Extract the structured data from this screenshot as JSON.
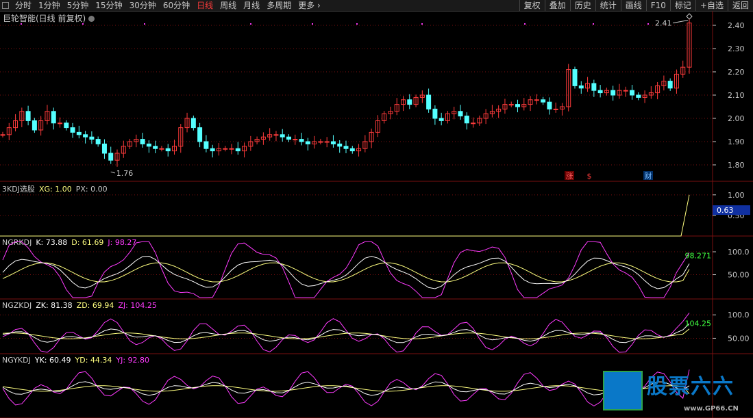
{
  "toolbar": {
    "periods": [
      "分时",
      "1分钟",
      "5分钟",
      "15分钟",
      "30分钟",
      "60分钟",
      "日线",
      "周线",
      "月线",
      "多周期",
      "更多"
    ],
    "active_period": "日线",
    "right_buttons": [
      "复权",
      "叠加",
      "历史",
      "统计",
      "画线",
      "F10",
      "标记",
      "+自选",
      "返回"
    ]
  },
  "title": "巨轮智能(日线 前复权)",
  "price_axis": [
    "2.40",
    "2.30",
    "2.20",
    "2.10",
    "2.00",
    "1.90",
    "1.80"
  ],
  "annotations": {
    "high_label": "2.41",
    "low_label": "1.76",
    "marker_zhang": "涨",
    "marker_s": "$",
    "marker_cai": "财"
  },
  "panels": {
    "kdj3": {
      "name": "3KDJ选股",
      "xg_label": "XG: 1.00",
      "px_label": "PX: 0.00",
      "axis": [
        "1.00",
        "0.50"
      ],
      "current": "0.63"
    },
    "ngrkdj": {
      "name": "NGRKDJ",
      "k_label": "K: 73.88",
      "d_label": "D: 61.69",
      "j_label": "J: 98.27",
      "axis": [
        "100.0",
        "50.00"
      ],
      "current": "98.271"
    },
    "ngzkdj": {
      "name": "NGZKDJ",
      "zk_label": "ZK: 81.38",
      "zd_label": "ZD: 69.94",
      "zj_label": "ZJ: 104.25",
      "axis": [
        "100.0",
        "50.00"
      ],
      "current": "104.25"
    },
    "ngykdj": {
      "name": "NGYKDJ",
      "yk_label": "YK: 60.49",
      "yd_label": "YD: 44.34",
      "yj_label": "YJ: 92.80"
    }
  },
  "watermark": {
    "brand": "股票六六",
    "url": "www.GP66.CN"
  },
  "colors": {
    "up": "#ff3b3b",
    "down": "#54ffff",
    "k_line": "#ffffff",
    "d_line": "#ffff80",
    "j_line": "#ff3bff",
    "grid": "#7a1010"
  },
  "price_series": [
    1.93,
    1.96,
    1.99,
    2.03,
    1.99,
    1.95,
    1.99,
    2.03,
    1.98,
    1.98,
    1.96,
    1.94,
    1.93,
    1.92,
    1.91,
    1.89,
    1.85,
    1.82,
    1.85,
    1.88,
    1.9,
    1.91,
    1.89,
    1.88,
    1.87,
    1.87,
    1.86,
    1.88,
    1.96,
    2.0,
    1.96,
    1.9,
    1.87,
    1.86,
    1.87,
    1.87,
    1.87,
    1.86,
    1.88,
    1.9,
    1.91,
    1.92,
    1.93,
    1.93,
    1.92,
    1.91,
    1.91,
    1.9,
    1.89,
    1.9,
    1.9,
    1.9,
    1.89,
    1.88,
    1.87,
    1.86,
    1.87,
    1.9,
    1.94,
    1.99,
    2.02,
    2.03,
    2.06,
    2.08,
    2.06,
    2.09,
    2.1,
    2.04,
    2.0,
    1.99,
    2.02,
    2.03,
    2.01,
    1.98,
    1.98,
    2.0,
    2.02,
    2.03,
    2.04,
    2.06,
    2.06,
    2.05,
    2.06,
    2.08,
    2.08,
    2.07,
    2.04,
    2.04,
    2.05,
    2.21,
    2.14,
    2.13,
    2.15,
    2.12,
    2.11,
    2.12,
    2.1,
    2.12,
    2.12,
    2.1,
    2.09,
    2.1,
    2.11,
    2.14,
    2.16,
    2.13,
    2.19,
    2.22,
    2.41
  ]
}
